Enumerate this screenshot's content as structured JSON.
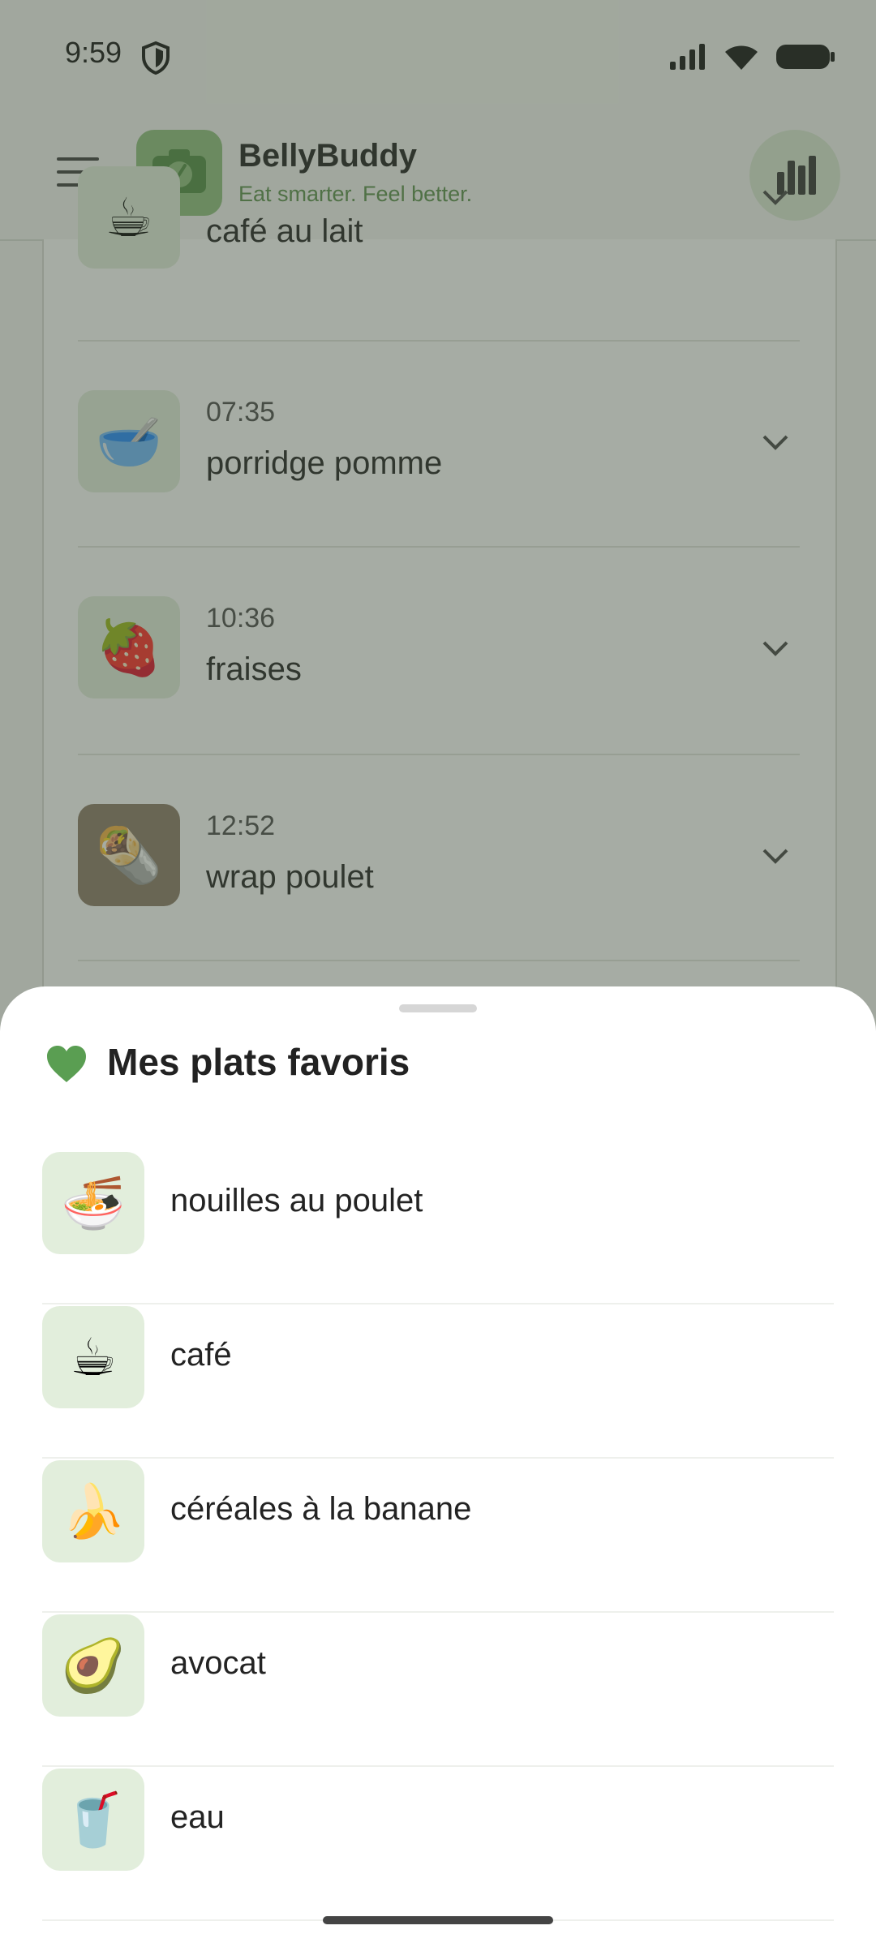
{
  "status_bar": {
    "time": "9:59"
  },
  "app_bar": {
    "title": "BellyBuddy",
    "tagline": "Eat smarter. Feel better."
  },
  "meals": [
    {
      "time": "",
      "name": "café au lait",
      "icon": "coffee-icon",
      "emoji": "☕"
    },
    {
      "time": "07:35",
      "name": "porridge pomme",
      "icon": "bowl-icon",
      "emoji": "🥣"
    },
    {
      "time": "10:36",
      "name": "fraises",
      "icon": "strawberry-icon",
      "emoji": "🍓"
    },
    {
      "time": "12:52",
      "name": "wrap poulet",
      "icon": "wrap-photo",
      "emoji": "🌯"
    }
  ],
  "favorites_sheet": {
    "title": "Mes plats favoris",
    "items": [
      {
        "label": "nouilles au poulet",
        "icon": "noodles-icon",
        "emoji": "🍜"
      },
      {
        "label": "café",
        "icon": "coffee-icon",
        "emoji": "☕"
      },
      {
        "label": "céréales à la banane",
        "icon": "banana-icon",
        "emoji": "🍌"
      },
      {
        "label": "avocat",
        "icon": "avocado-icon",
        "emoji": "🥑"
      },
      {
        "label": "eau",
        "icon": "water-glass-icon",
        "emoji": "🥤"
      }
    ]
  },
  "colors": {
    "accent_green": "#5a8e4c",
    "scrim": "#465240",
    "tile_bg": "#e2eedc"
  }
}
